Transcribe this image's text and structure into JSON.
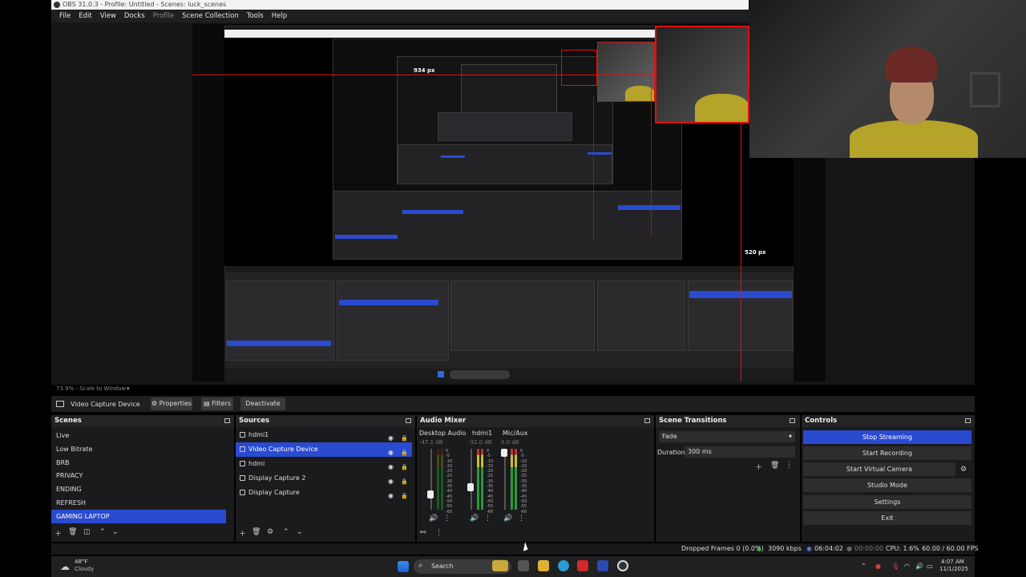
{
  "window": {
    "title": "OBS 31.0.3 - Profile: Untitled - Scenes: luck_scenes",
    "menu": [
      "File",
      "Edit",
      "View",
      "Docks",
      "Profile",
      "Scene Collection",
      "Tools",
      "Help"
    ]
  },
  "preview": {
    "measure_top": "934 px",
    "measure_right": "520 px",
    "scale_label": "73.9% - Scale to Window"
  },
  "context_bar": {
    "source_name": "Video Capture Device",
    "properties_label": "Properties",
    "filters_label": "Filters",
    "deactivate_label": "Deactivate"
  },
  "scenes": {
    "title": "Scenes",
    "items": [
      "Live",
      "Low Bitrate",
      "BRB",
      "PRIVACY",
      "ENDING",
      "REFRESH",
      "GAMING LAPTOP"
    ],
    "selected": "GAMING LAPTOP"
  },
  "sources": {
    "title": "Sources",
    "items": [
      "hdmi1",
      "Video Capture Device",
      "hdmi",
      "Display Capture 2",
      "Display Capture"
    ],
    "selected": "Video Capture Device"
  },
  "audio_mixer": {
    "title": "Audio Mixer",
    "channels": [
      {
        "name": "Desktop Audio",
        "db": "-47.1 dB"
      },
      {
        "name": "hdmi1",
        "db": "-32.0 dB"
      },
      {
        "name": "Mic/Aux",
        "db": "0.0 dB"
      }
    ],
    "scale": [
      "0",
      "-5",
      "-10",
      "-15",
      "-20",
      "-25",
      "-30",
      "-35",
      "-40",
      "-45",
      "-50",
      "-55",
      "-60"
    ]
  },
  "scene_transitions": {
    "title": "Scene Transitions",
    "transition": "Fade",
    "duration_label": "Duration",
    "duration_value": "300 ms"
  },
  "controls": {
    "title": "Controls",
    "buttons": [
      "Stop Streaming",
      "Start Recording",
      "Start Virtual Camera",
      "Studio Mode",
      "Settings",
      "Exit"
    ]
  },
  "status": {
    "dropped_frames": "Dropped Frames 0 (0.0%)",
    "bitrate": "3090 kbps",
    "stream_time": "06:04:02",
    "record_time": "00:00:00",
    "cpu": "CPU: 1.6%",
    "fps": "60.00 / 60.00 FPS"
  },
  "taskbar": {
    "weather_temp": "48°F",
    "weather_desc": "Cloudy",
    "search_placeholder": "Search",
    "time": "4:07 AM",
    "date": "11/1/2025"
  },
  "colors": {
    "accent": "#2a4ad0",
    "measure_line": "#e01010",
    "dock_bg": "#1b1b1d"
  }
}
